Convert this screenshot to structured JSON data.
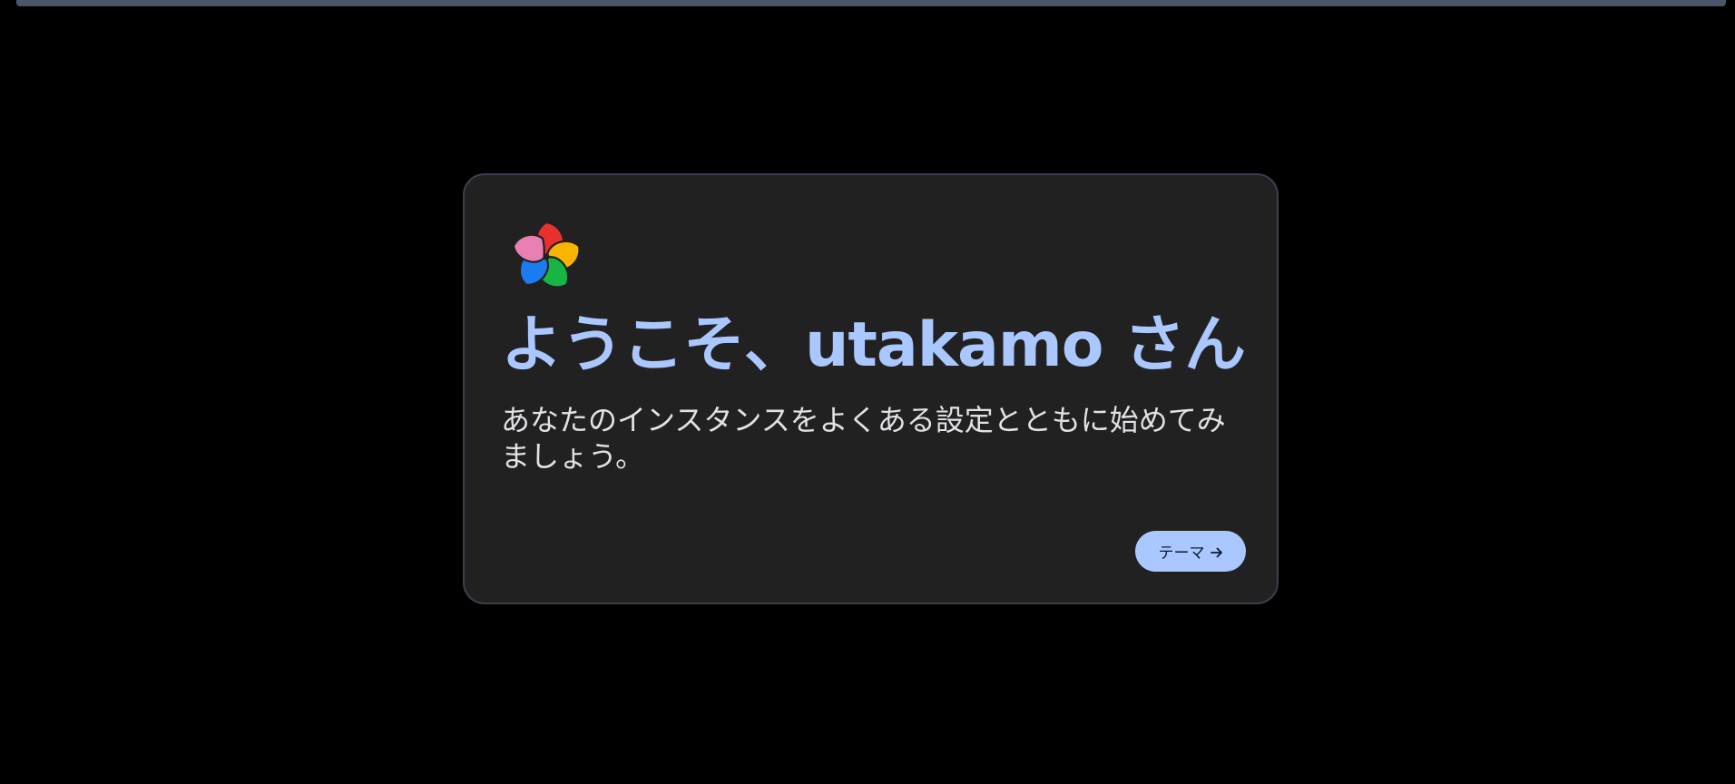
{
  "onboarding": {
    "title": "ようこそ、utakamo さん",
    "subtitle": "あなたのインスタンスをよくある設定とともに始めてみましょう。",
    "next_button_label": "テーマ",
    "next_icon": "arrow-right-icon",
    "logo_icon": "pinwheel-logo"
  },
  "colors": {
    "background": "#000000",
    "card_background": "#212121",
    "card_border": "#3a3f4b",
    "accent": "#aac7ff",
    "progress_bar": "#4a5568",
    "text_secondary": "#e2e2e6",
    "logo_red": "#ea2f2f",
    "logo_yellow": "#f7b500",
    "logo_green": "#17b544",
    "logo_blue": "#1a7cf0",
    "logo_pink": "#ea7fb3"
  }
}
